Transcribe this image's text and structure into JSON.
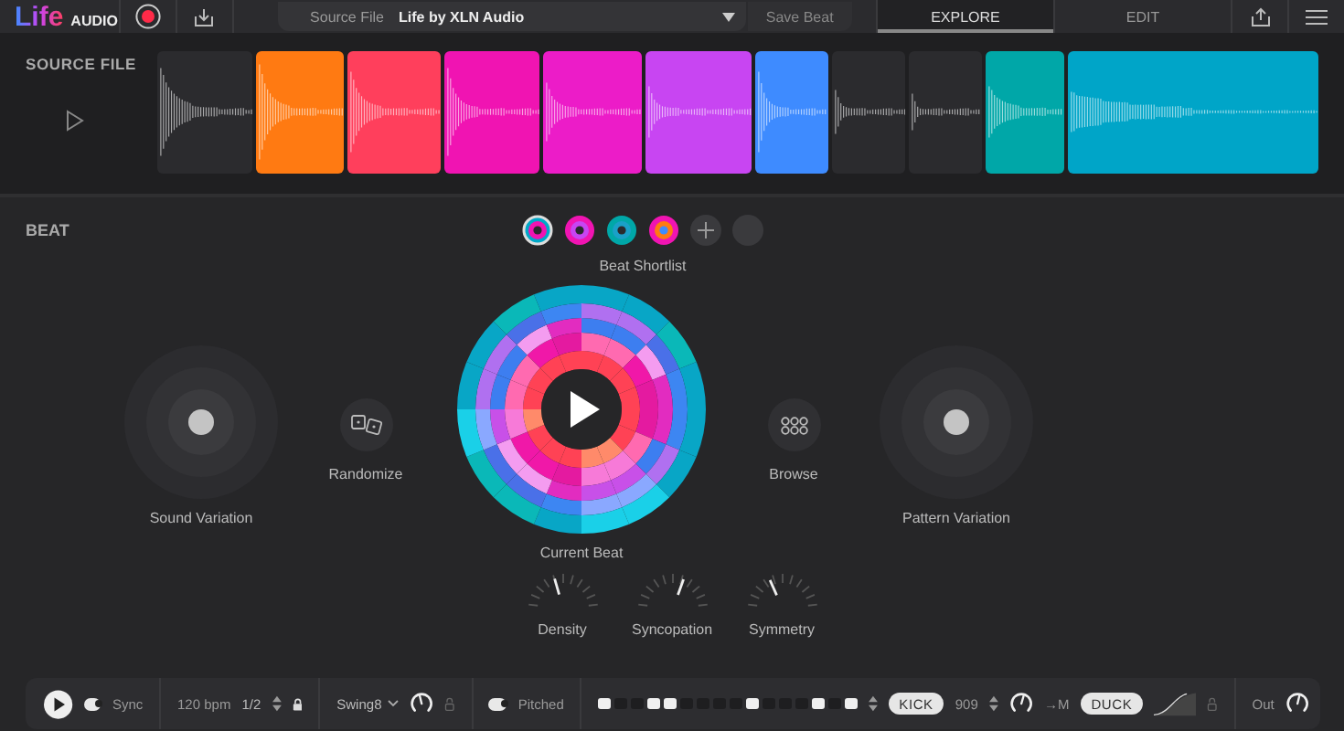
{
  "header": {
    "logo": "Life",
    "logo_sub": "AUDIO",
    "source_field": {
      "label": "Source File",
      "value": "Life by XLN Audio"
    },
    "save_button": "Save Beat",
    "tabs": [
      {
        "label": "EXPLORE",
        "selected": true
      },
      {
        "label": "EDIT",
        "selected": false
      }
    ]
  },
  "source": {
    "title": "SOURCE FILE",
    "segments": [
      {
        "color": "#2b2b2e"
      },
      {
        "color": "#ff7a12"
      },
      {
        "color": "#ff3f5c"
      },
      {
        "color": "#f014b2"
      },
      {
        "color": "#ec1cc8"
      },
      {
        "color": "#c845f2"
      },
      {
        "color": "#3e8bff"
      },
      {
        "color": "#2b2b2e"
      },
      {
        "color": "#2b2b2e"
      },
      {
        "color": "#00a7a8"
      },
      {
        "color": "#00a5c8"
      }
    ]
  },
  "beat": {
    "title": "BEAT",
    "shortlist": [
      {
        "selected": true
      },
      {
        "selected": false
      },
      {
        "selected": false
      },
      {
        "selected": false
      }
    ],
    "shortlist_label": "Beat Shortlist",
    "sound_variation": "Sound Variation",
    "randomize": "Randomize",
    "current_beat": "Current Beat",
    "browse": "Browse",
    "pattern_variation": "Pattern Variation",
    "knobs": [
      {
        "label": "Density",
        "level": 0.42
      },
      {
        "label": "Syncopation",
        "level": 0.6
      },
      {
        "label": "Symmetry",
        "level": 0.38
      }
    ]
  },
  "transport": {
    "sync": {
      "label": "Sync",
      "on": true
    },
    "tempo": "120 bpm",
    "division": "1/2",
    "division_locked": true,
    "swing": "Swing8",
    "swing_knob": {
      "level": 0.45
    },
    "swing_locked": false,
    "pitched": {
      "label": "Pitched",
      "on": true
    },
    "steps": [
      {
        "on": true
      },
      {
        "on": false
      },
      {
        "on": false
      },
      {
        "on": true
      },
      {
        "on": true
      },
      {
        "on": false
      },
      {
        "on": false
      },
      {
        "on": false
      },
      {
        "on": false
      },
      {
        "on": true
      },
      {
        "on": false
      },
      {
        "on": false
      },
      {
        "on": false
      },
      {
        "on": true
      },
      {
        "on": false
      },
      {
        "on": true
      }
    ],
    "kick": "KICK",
    "kit": "909",
    "kit_knob": {
      "level": 0.56
    },
    "route": "→M",
    "duck": "DUCK",
    "duck_locked": false,
    "out": "Out",
    "out_knob": {
      "level": 0.55
    }
  }
}
